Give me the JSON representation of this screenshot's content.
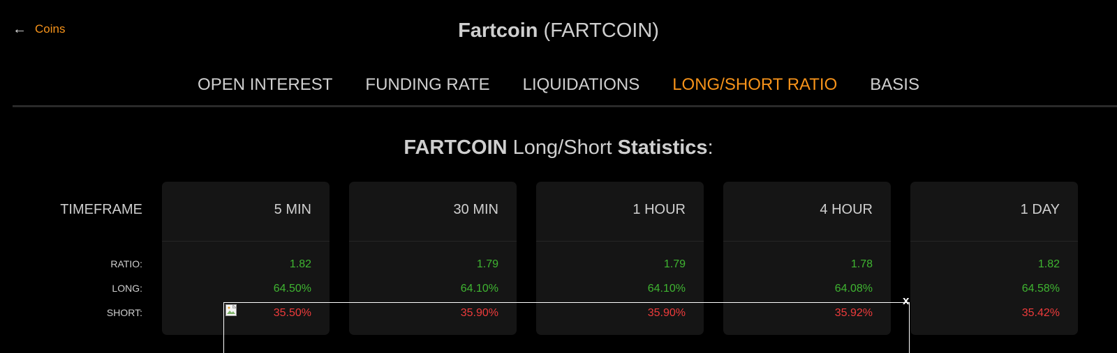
{
  "nav": {
    "back_label": "Coins"
  },
  "header": {
    "coin_name": "Fartcoin",
    "coin_symbol": "(FARTCOIN)"
  },
  "tabs": [
    {
      "label": "OPEN INTEREST",
      "active": false
    },
    {
      "label": "FUNDING RATE",
      "active": false
    },
    {
      "label": "LIQUIDATIONS",
      "active": false
    },
    {
      "label": "LONG/SHORT RATIO",
      "active": true
    },
    {
      "label": "BASIS",
      "active": false
    }
  ],
  "stats": {
    "title_symbol": "FARTCOIN",
    "title_middle": "Long/Short",
    "title_bold": "Statistics",
    "title_suffix": ":",
    "row_labels": {
      "timeframe": "TIMEFRAME",
      "ratio": "RATIO:",
      "long": "LONG:",
      "short": "SHORT:"
    },
    "timeframes": [
      {
        "label": "5 MIN",
        "ratio": "1.82",
        "long": "64.50%",
        "short": "35.50%"
      },
      {
        "label": "30 MIN",
        "ratio": "1.79",
        "long": "64.10%",
        "short": "35.90%"
      },
      {
        "label": "1 HOUR",
        "ratio": "1.79",
        "long": "64.10%",
        "short": "35.90%"
      },
      {
        "label": "4 HOUR",
        "ratio": "1.78",
        "long": "64.08%",
        "short": "35.92%"
      },
      {
        "label": "1 DAY",
        "ratio": "1.82",
        "long": "64.58%",
        "short": "35.42%"
      }
    ]
  },
  "overlay": {
    "close_label": "x"
  },
  "colors": {
    "accent": "#f7931a",
    "long": "#3fb531",
    "short": "#ee3b3b",
    "card_bg": "#151515"
  }
}
